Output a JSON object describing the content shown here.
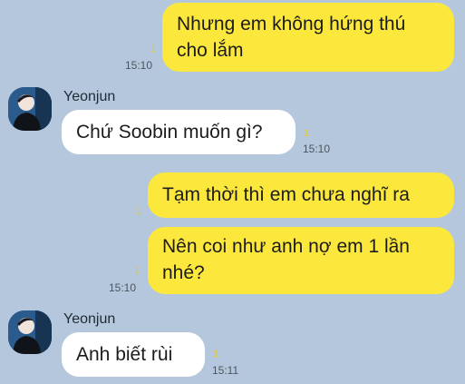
{
  "messages": [
    {
      "type": "sent",
      "text": "Nhưng em không hứng thú\ncho lắm",
      "read": "1",
      "time": "15:10"
    },
    {
      "type": "recv",
      "sender": "Yeonjun",
      "text": "Chứ Soobin muốn gì?",
      "read": "1",
      "time": "15:10"
    },
    {
      "type": "sent",
      "text": "Tạm thời thì em chưa nghĩ ra",
      "read": "1",
      "time": ""
    },
    {
      "type": "sent",
      "text": "Nên coi như anh nợ em 1 lần\nnhé?",
      "read": "1",
      "time": "15:10"
    },
    {
      "type": "recv",
      "sender": "Yeonjun",
      "text": "Anh biết rùi",
      "read": "1",
      "time": "15:11"
    }
  ],
  "colors": {
    "background": "#b5c7dc",
    "sent_bubble": "#fce83c",
    "recv_bubble": "#ffffff",
    "read_count": "#e0c83a"
  }
}
